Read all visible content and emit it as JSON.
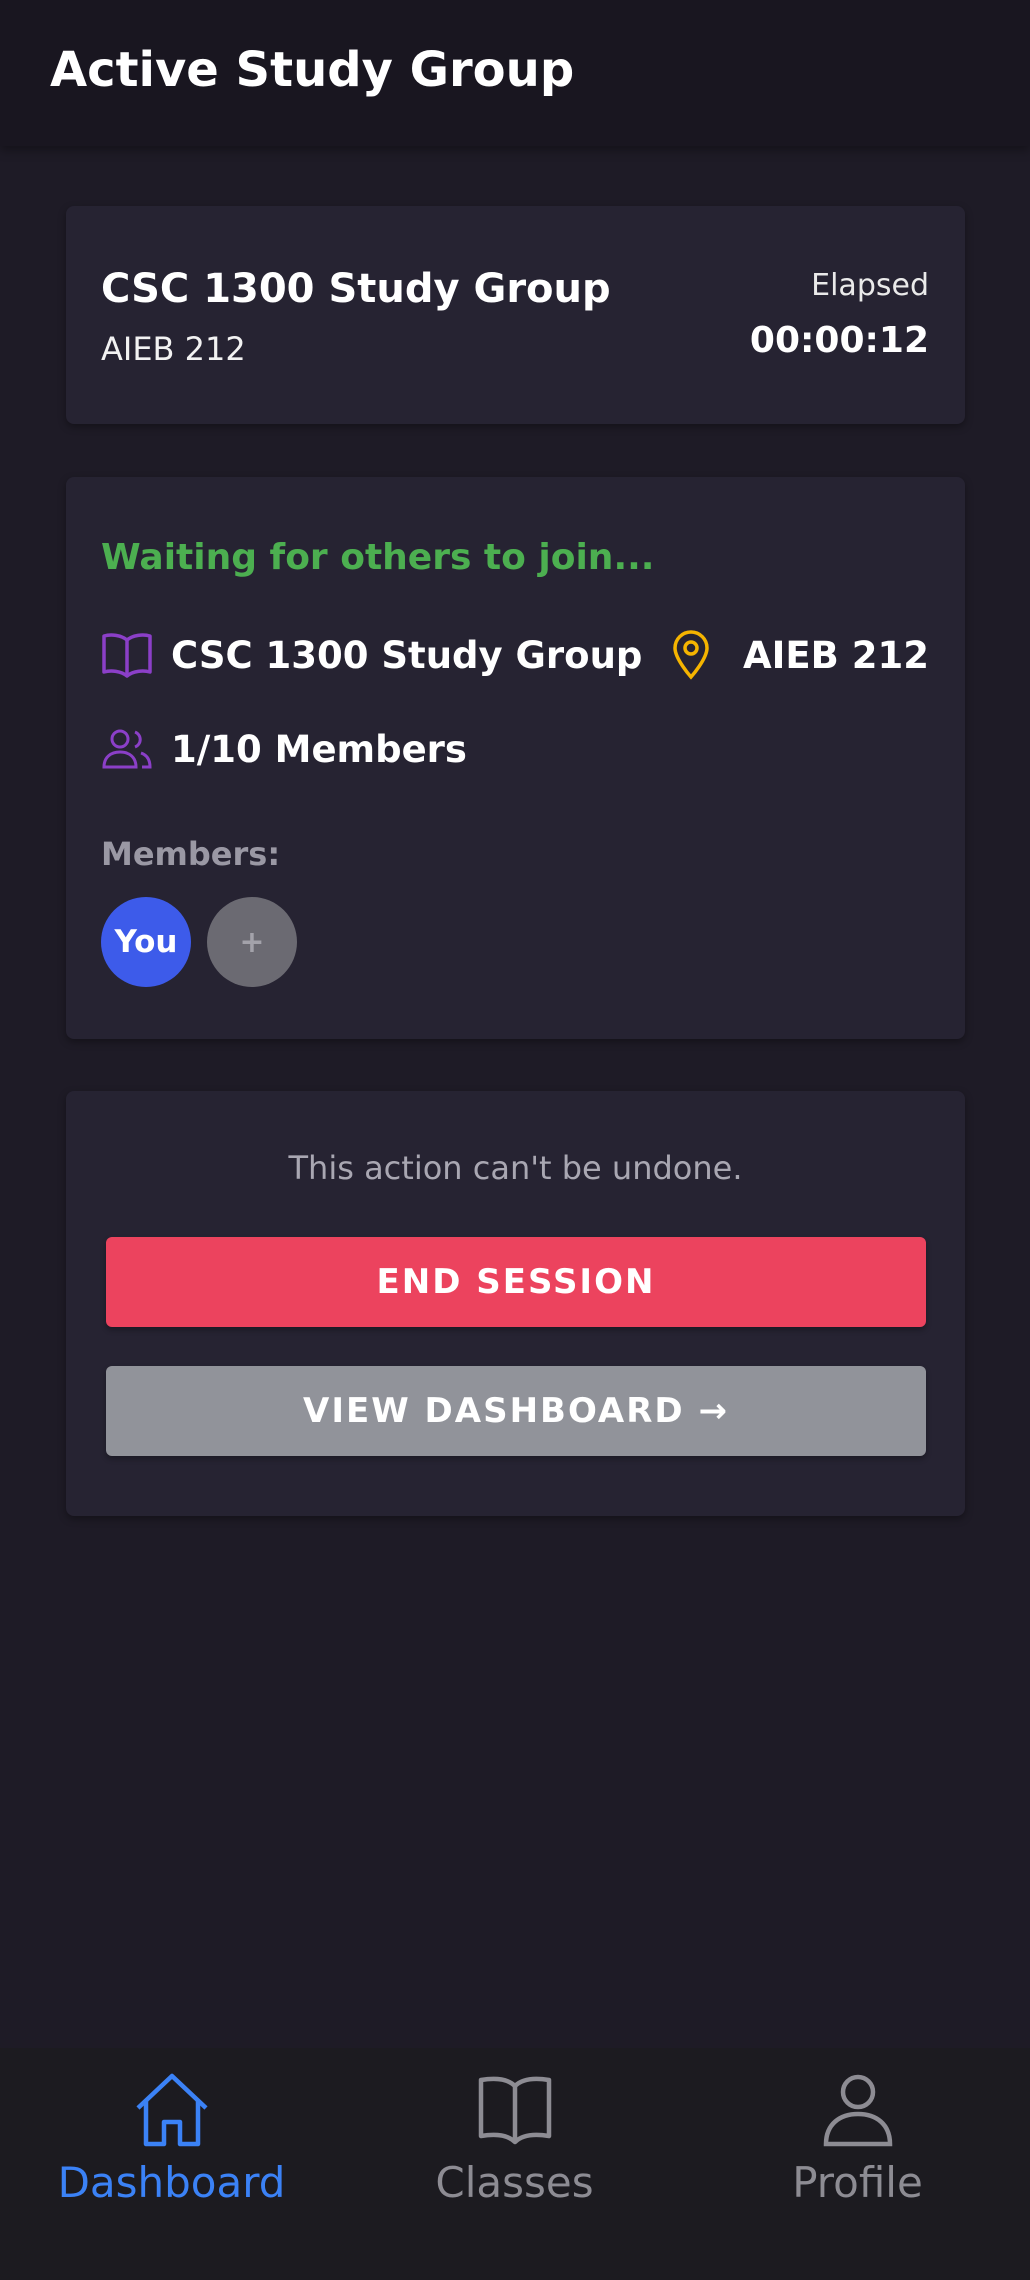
{
  "header": {
    "title": "Active Study Group"
  },
  "session": {
    "group_name": "CSC 1300 Study Group",
    "room": "AIEB 212",
    "elapsed_label": "Elapsed",
    "elapsed_value": "00:00:12"
  },
  "status": {
    "waiting_text": "Waiting for others to join...",
    "group_name": "CSC 1300 Study Group",
    "room": "AIEB 212",
    "members_count": "1/10 Members",
    "members_label": "Members:",
    "avatars": [
      {
        "label": "You",
        "color": "#3d5bea"
      },
      {
        "label": "+",
        "color": "#6b6a72"
      }
    ],
    "status_color": "#4caf50",
    "book_icon": "book-open-icon",
    "location_icon": "map-pin-icon",
    "members_icon": "users-icon"
  },
  "actions": {
    "warning": "This action can't be undone.",
    "end_label": "END SESSION",
    "dashboard_label": "VIEW DASHBOARD →",
    "end_color": "#ec435e",
    "dashboard_color": "#91939a"
  },
  "nav": {
    "items": [
      {
        "label": "Dashboard",
        "icon": "home-icon",
        "active": true
      },
      {
        "label": "Classes",
        "icon": "book-icon",
        "active": false
      },
      {
        "label": "Profile",
        "icon": "user-icon",
        "active": false
      }
    ],
    "active_color": "#3b82f6"
  }
}
